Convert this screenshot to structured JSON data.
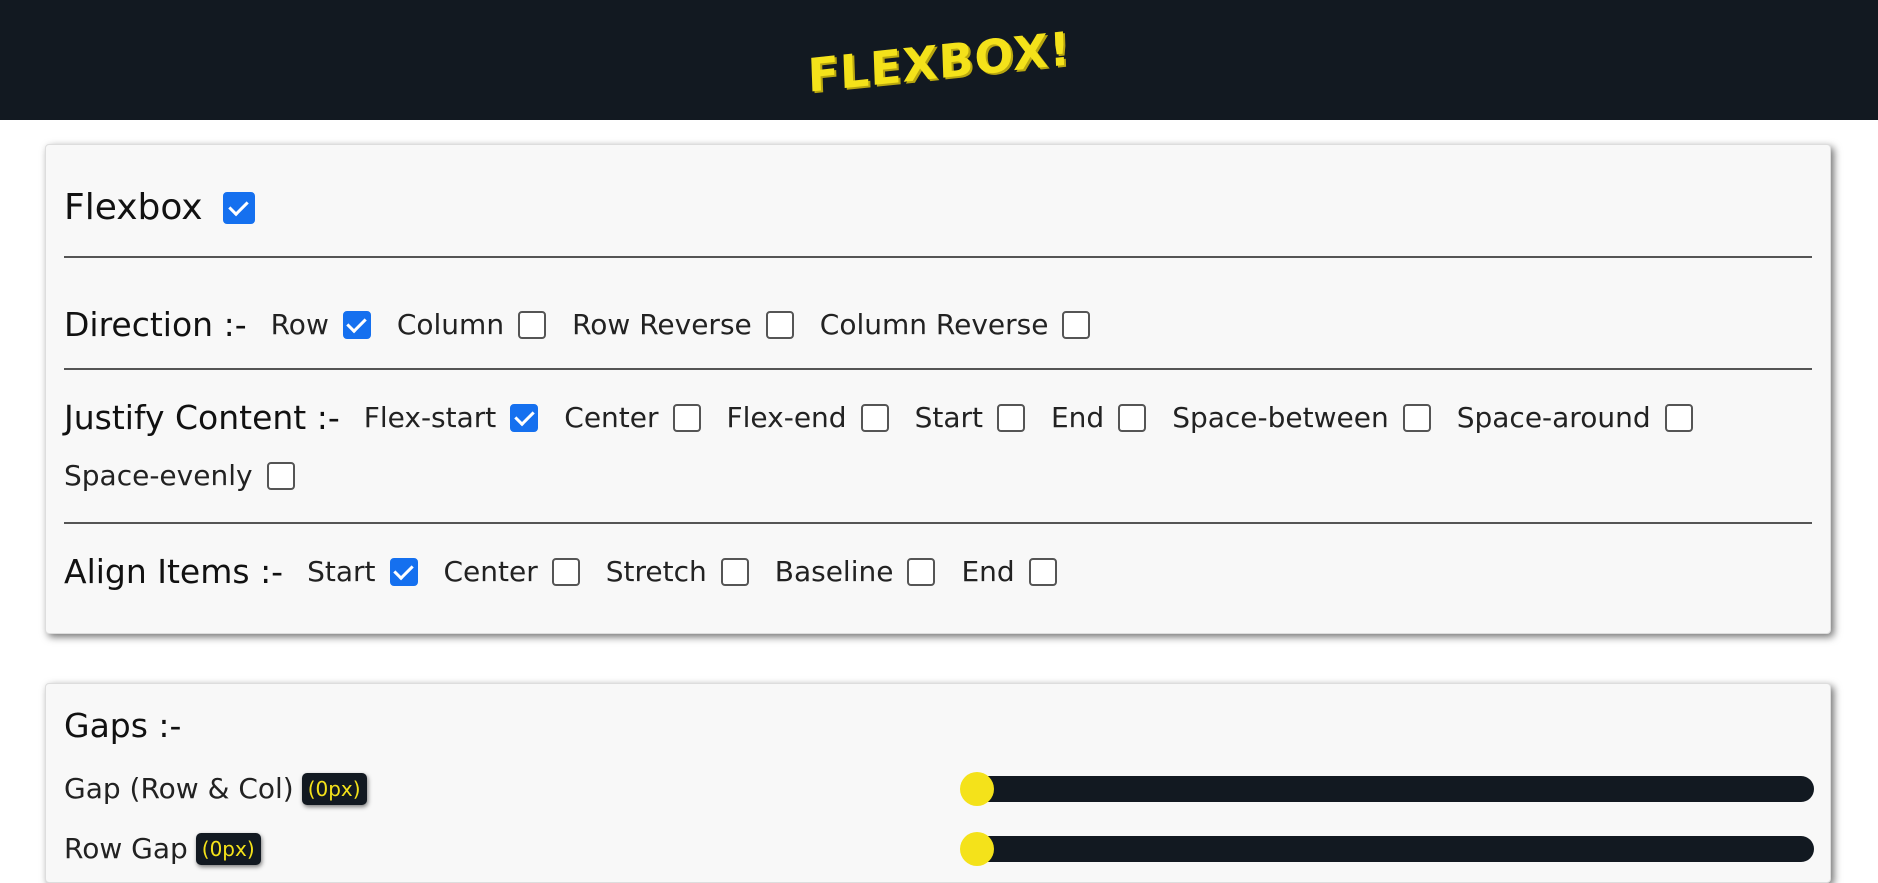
{
  "header": {
    "logo": "FLEXBOX!"
  },
  "flexbox": {
    "title": "Flexbox",
    "enabled": true,
    "direction": {
      "title": "Direction :-",
      "options": [
        {
          "label": "Row",
          "checked": true
        },
        {
          "label": "Column",
          "checked": false
        },
        {
          "label": "Row Reverse",
          "checked": false
        },
        {
          "label": "Column Reverse",
          "checked": false
        }
      ]
    },
    "justify": {
      "title": "Justify Content :-",
      "options": [
        {
          "label": "Flex-start",
          "checked": true
        },
        {
          "label": "Center",
          "checked": false
        },
        {
          "label": "Flex-end",
          "checked": false
        },
        {
          "label": "Start",
          "checked": false
        },
        {
          "label": "End",
          "checked": false
        },
        {
          "label": "Space-between",
          "checked": false
        },
        {
          "label": "Space-around",
          "checked": false
        },
        {
          "label": "Space-evenly",
          "checked": false
        }
      ]
    },
    "align": {
      "title": "Align Items :-",
      "options": [
        {
          "label": "Start",
          "checked": true
        },
        {
          "label": "Center",
          "checked": false
        },
        {
          "label": "Stretch",
          "checked": false
        },
        {
          "label": "Baseline",
          "checked": false
        },
        {
          "label": "End",
          "checked": false
        }
      ]
    }
  },
  "gaps": {
    "title": "Gaps :-",
    "gap": {
      "label": "Gap (Row & Col)",
      "value": "(0px)",
      "fraction": 0
    },
    "row_gap": {
      "label": "Row Gap",
      "value": "(0px)",
      "fraction": 0
    }
  },
  "colors": {
    "accent": "#f4e21a",
    "dark": "#121921",
    "checkbox": "#1570ef"
  }
}
